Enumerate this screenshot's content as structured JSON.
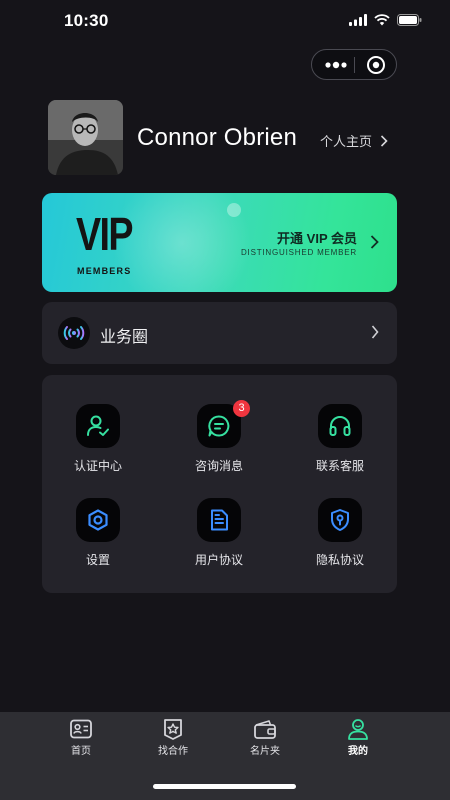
{
  "status_bar": {
    "time": "10:30"
  },
  "profile": {
    "name": "Connor Obrien",
    "homepage_label": "个人主页"
  },
  "vip": {
    "logo_text": "VIP",
    "members_text": "MEMBERS",
    "title": "开通 VIP 会员",
    "subtitle": "DISTINGUISHED MEMBER"
  },
  "business_circle": {
    "label": "业务圈"
  },
  "grid": {
    "items": [
      {
        "label": "认证中心",
        "icon": "user-check-icon"
      },
      {
        "label": "咨询消息",
        "icon": "chat-icon",
        "badge": "3"
      },
      {
        "label": "联系客服",
        "icon": "headphones-icon"
      },
      {
        "label": "设置",
        "icon": "settings-icon"
      },
      {
        "label": "用户协议",
        "icon": "document-icon"
      },
      {
        "label": "隐私协议",
        "icon": "shield-lock-icon"
      }
    ]
  },
  "tabs": [
    {
      "label": "首页",
      "icon": "id-card-icon"
    },
    {
      "label": "找合作",
      "icon": "star-badge-icon"
    },
    {
      "label": "名片夹",
      "icon": "wallet-icon"
    },
    {
      "label": "我的",
      "icon": "person-icon",
      "active": true
    }
  ],
  "colors": {
    "accent": "#36e0a0",
    "background": "#151419",
    "card": "#24232a",
    "badge": "#f0353f"
  }
}
